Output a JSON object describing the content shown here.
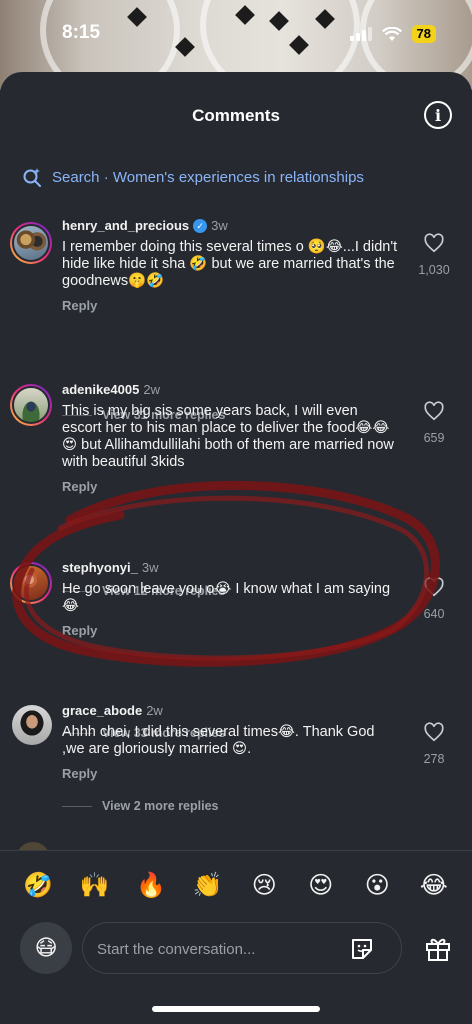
{
  "status_bar": {
    "time": "8:15",
    "battery": "78"
  },
  "header": {
    "title": "Comments",
    "info_icon": "info-icon"
  },
  "search": {
    "prefix": "Search",
    "separator": " · ",
    "query": "Women's experiences in relationships"
  },
  "comments": [
    {
      "username": "henry_and_precious",
      "verified": true,
      "time": "3w",
      "text": "I remember doing this several times o 🥺😂...I didn't hide like hide it sha 🤣 but we are married that's the goodnews🤫🤣",
      "reply": "Reply",
      "likes": "1,030",
      "view_replies": "View 31 more replies"
    },
    {
      "username": "adenike4005",
      "verified": false,
      "time": "2w",
      "text": "This is my big sis some years back, I will even escort her to his man place to deliver the food😂😂😍 but Allihamdullilahi both of them are married now with beautiful 3kids",
      "reply": "Reply",
      "likes": "659",
      "view_replies": "View 12 more replies"
    },
    {
      "username": "stephyonyi_",
      "verified": false,
      "time": "3w",
      "text": "He go soon leave you o😭 I know what I am saying 😂",
      "reply": "Reply",
      "likes": "640",
      "view_replies": "View 33 more replies"
    },
    {
      "username": "grace_abode",
      "verified": false,
      "time": "2w",
      "text": "Ahhh chei, I did this several times😂. Thank God ,we are gloriously married 😍.",
      "reply": "Reply",
      "likes": "278",
      "view_replies": "View 2 more replies"
    }
  ],
  "emoji_bar": [
    "🤣",
    "🙌",
    "🔥",
    "👏",
    "😢",
    "😍",
    "😮",
    "😂"
  ],
  "composer": {
    "placeholder": "Start the conversation...",
    "avatar_emoji": "😷"
  },
  "colors": {
    "background": "#262a30",
    "link": "#8ab4f8",
    "muted": "#9aa0a6",
    "annotation": "#8b1a1a"
  }
}
